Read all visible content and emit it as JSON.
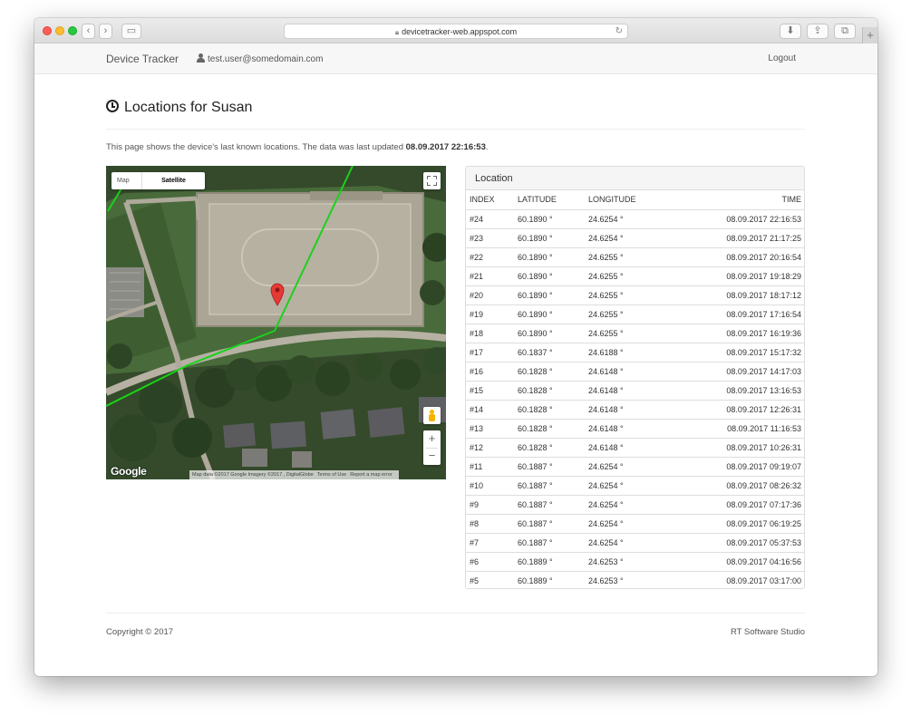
{
  "browser": {
    "url": "devicetracker-web.appspot.com",
    "nav_back_icon": "chevron-left-icon",
    "nav_forward_icon": "chevron-right-icon"
  },
  "navbar": {
    "brand": "Device Tracker",
    "user_email": "test.user@somedomain.com",
    "logout_label": "Logout"
  },
  "page": {
    "title": "Locations for Susan",
    "intro_text": "This page shows the device's last known locations. The data was last updated ",
    "last_updated": "08.09.2017 22:16:53",
    "intro_end": "."
  },
  "map": {
    "type_map_label": "Map",
    "type_satellite_label": "Satellite",
    "zoom_in_label": "+",
    "zoom_out_label": "−",
    "logo": "Google",
    "attribution": "Map data ©2017 Google Imagery ©2017 , DigitalGlobe",
    "terms": "Terms of Use",
    "report": "Report a map error",
    "track_color": "#19d21b",
    "marker_color": "#e53935"
  },
  "table": {
    "heading": "Location",
    "columns": [
      "INDEX",
      "LATITUDE",
      "LONGITUDE",
      "TIME"
    ],
    "rows": [
      [
        "#24",
        "60.1890 °",
        "24.6254 °",
        "08.09.2017 22:16:53"
      ],
      [
        "#23",
        "60.1890 °",
        "24.6254 °",
        "08.09.2017 21:17:25"
      ],
      [
        "#22",
        "60.1890 °",
        "24.6255 °",
        "08.09.2017 20:16:54"
      ],
      [
        "#21",
        "60.1890 °",
        "24.6255 °",
        "08.09.2017 19:18:29"
      ],
      [
        "#20",
        "60.1890 °",
        "24.6255 °",
        "08.09.2017 18:17:12"
      ],
      [
        "#19",
        "60.1890 °",
        "24.6255 °",
        "08.09.2017 17:16:54"
      ],
      [
        "#18",
        "60.1890 °",
        "24.6255 °",
        "08.09.2017 16:19:36"
      ],
      [
        "#17",
        "60.1837 °",
        "24.6188 °",
        "08.09.2017 15:17:32"
      ],
      [
        "#16",
        "60.1828 °",
        "24.6148 °",
        "08.09.2017 14:17:03"
      ],
      [
        "#15",
        "60.1828 °",
        "24.6148 °",
        "08.09.2017 13:16:53"
      ],
      [
        "#14",
        "60.1828 °",
        "24.6148 °",
        "08.09.2017 12:26:31"
      ],
      [
        "#13",
        "60.1828 °",
        "24.6148 °",
        "08.09.2017 11:16:53"
      ],
      [
        "#12",
        "60.1828 °",
        "24.6148 °",
        "08.09.2017 10:26:31"
      ],
      [
        "#11",
        "60.1887 °",
        "24.6254 °",
        "08.09.2017 09:19:07"
      ],
      [
        "#10",
        "60.1887 °",
        "24.6254 °",
        "08.09.2017 08:26:32"
      ],
      [
        "#9",
        "60.1887 °",
        "24.6254 °",
        "08.09.2017 07:17:36"
      ],
      [
        "#8",
        "60.1887 °",
        "24.6254 °",
        "08.09.2017 06:19:25"
      ],
      [
        "#7",
        "60.1887 °",
        "24.6254 °",
        "08.09.2017 05:37:53"
      ],
      [
        "#6",
        "60.1889 °",
        "24.6253 °",
        "08.09.2017 04:16:56"
      ],
      [
        "#5",
        "60.1889 °",
        "24.6253 °",
        "08.09.2017 03:17:00"
      ]
    ]
  },
  "footer": {
    "copyright": "Copyright © 2017",
    "company": "RT Software Studio"
  }
}
